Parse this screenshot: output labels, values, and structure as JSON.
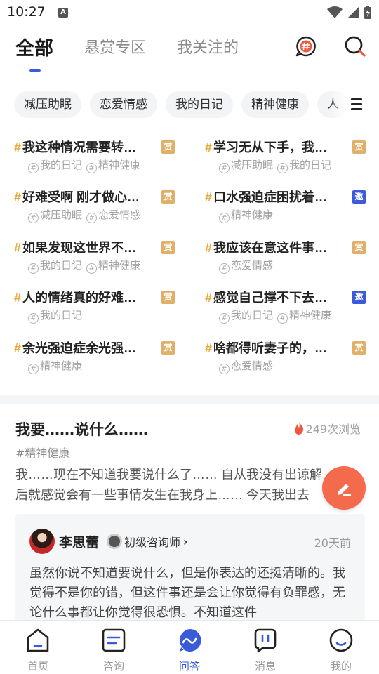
{
  "status_bar": {
    "time": "10:27",
    "notification_letter": "A"
  },
  "top_tabs": [
    "全部",
    "悬赏专区",
    "我关注的"
  ],
  "active_tab": "全部",
  "chips": [
    "减压助眠",
    "恋爱情感",
    "我的日记",
    "精神健康",
    "人"
  ],
  "topics": [
    {
      "title": "我这种情况需要转…",
      "badge": "赏",
      "badge_type": "reward",
      "tags": [
        "我的日记",
        "精神健康"
      ]
    },
    {
      "title": "学习无从下手，我…",
      "badge": "赏",
      "badge_type": "reward",
      "tags": [
        "减压助眠",
        "我的日记"
      ]
    },
    {
      "title": "好难受啊 刚才做心…",
      "badge": "赏",
      "badge_type": "reward",
      "tags": [
        "减压助眠",
        "恋爱情感"
      ]
    },
    {
      "title": "口水强迫症困扰着…",
      "badge": "邀",
      "badge_type": "invite",
      "tags": [
        "精神健康"
      ]
    },
    {
      "title": "如果发现这世界不…",
      "badge": "赏",
      "badge_type": "reward",
      "tags": [
        "我的日记",
        "精神健康"
      ]
    },
    {
      "title": "我应该在意这件事…",
      "badge": "赏",
      "badge_type": "reward",
      "tags": [
        "恋爱情感"
      ]
    },
    {
      "title": "人的情绪真的好难…",
      "badge": "赏",
      "badge_type": "reward",
      "tags": [
        "我的日记"
      ]
    },
    {
      "title": "感觉自己撑不下去…",
      "badge": "邀",
      "badge_type": "invite",
      "tags": [
        "我的日记",
        "精神健康"
      ]
    },
    {
      "title": "余光强迫症余光强…",
      "badge": "赏",
      "badge_type": "reward",
      "tags": [
        "精神健康"
      ]
    },
    {
      "title": "啥都得听妻子的，…",
      "badge": "赏",
      "badge_type": "reward",
      "tags": [
        "恋爱情感"
      ]
    }
  ],
  "post": {
    "title": "我要……说什么……",
    "views": "249次浏览",
    "tag": "#精神健康",
    "body": "我……现在不知道我要说什么了…… 自从我没有出谅解后就感觉会有一些事情发生在我身上…… 今天我出去",
    "answer": {
      "author": "李思蕾",
      "role": "初级咨询师",
      "time": "20天前",
      "body": "虽然你说不知道要说什么，但是你表达的还挺清晰的。我觉得不是你的错，但这件事还是会让你觉得有负罪感，无论什么事都让你觉得很恐惧。不知道这件"
    }
  },
  "bottom_nav": [
    {
      "label": "首页",
      "icon": "home-icon"
    },
    {
      "label": "咨询",
      "icon": "consult-icon"
    },
    {
      "label": "问答",
      "icon": "qa-icon"
    },
    {
      "label": "消息",
      "icon": "message-icon"
    },
    {
      "label": "我的",
      "icon": "profile-icon"
    }
  ],
  "active_nav": "问答",
  "colors": {
    "accent": "#3a5bd9",
    "reward_badge": "#e0b06a",
    "invite_badge": "#3a5bd9",
    "fab": "#f46a4d",
    "hash": "#e8a93a"
  }
}
